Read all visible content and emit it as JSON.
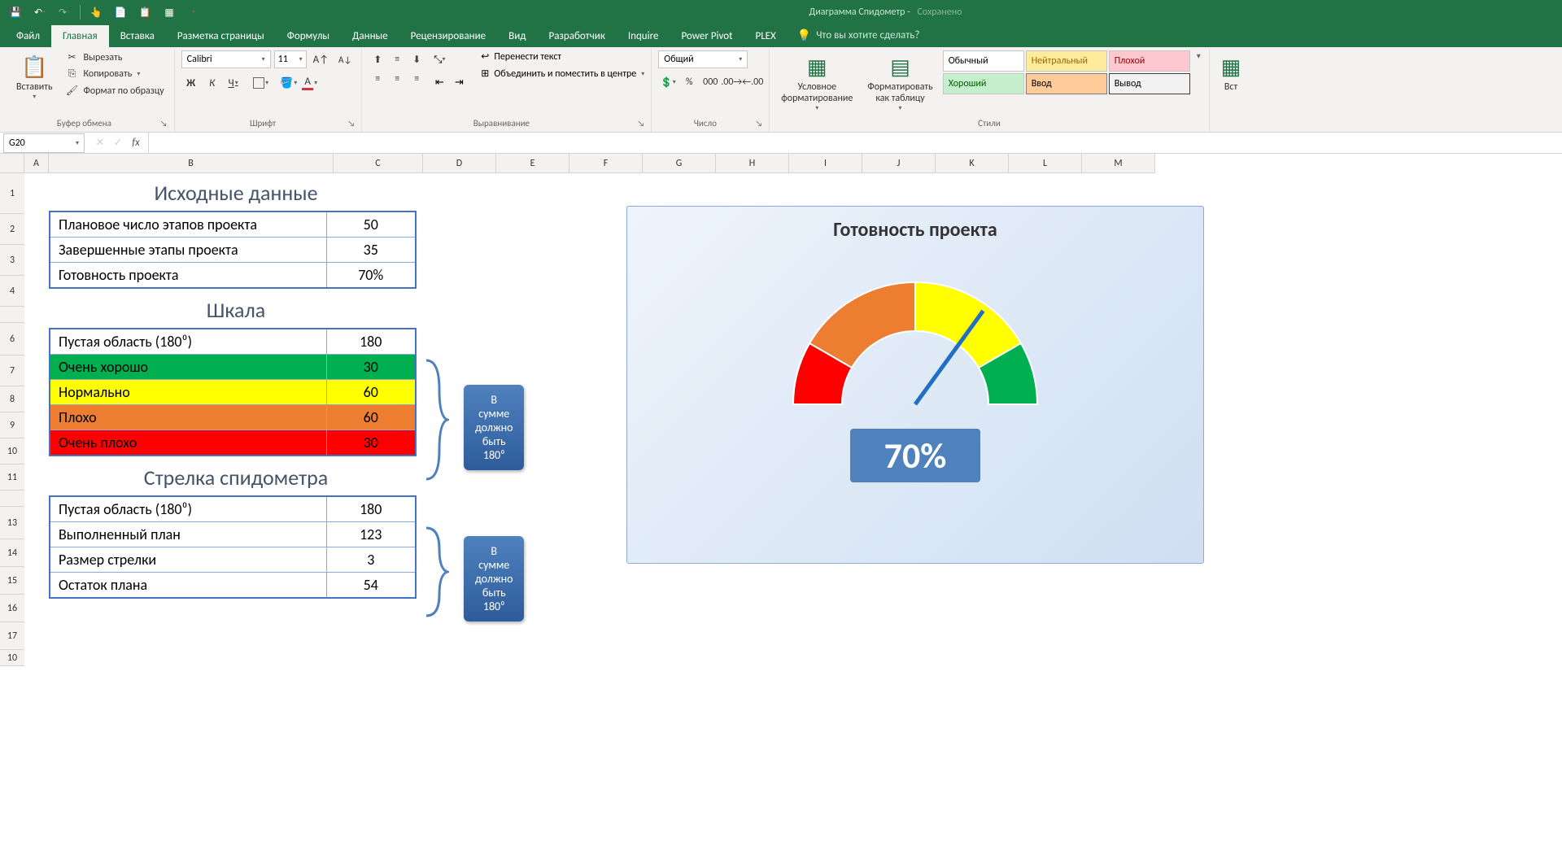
{
  "app": {
    "doc_name": "Диаграмма Спидометр",
    "saved_label": "Сохранено"
  },
  "tabs": {
    "file": "Файл",
    "home": "Главная",
    "insert": "Вставка",
    "layout": "Разметка страницы",
    "formulas": "Формулы",
    "data": "Данные",
    "review": "Рецензирование",
    "view": "Вид",
    "developer": "Разработчик",
    "inquire": "Inquire",
    "powerpivot": "Power Pivot",
    "plex": "PLEX",
    "tell_me": "Что вы хотите сделать?"
  },
  "ribbon": {
    "clipboard": {
      "paste": "Вставить",
      "cut": "Вырезать",
      "copy": "Копировать",
      "format_painter": "Формат по образцу",
      "label": "Буфер обмена"
    },
    "font": {
      "name": "Calibri",
      "size": "11",
      "label": "Шрифт"
    },
    "alignment": {
      "wrap": "Перенести текст",
      "merge": "Объединить и поместить в центре",
      "label": "Выравнивание"
    },
    "number": {
      "format": "Общий",
      "label": "Число"
    },
    "styles": {
      "cond": "Условное\nформатирование",
      "table": "Форматировать\nкак таблицу",
      "s1": "Обычный",
      "s2": "Нейтральный",
      "s3": "Плохой",
      "s4": "Хороший",
      "s5": "Ввод",
      "s6": "Вывод",
      "label": "Стили"
    },
    "insert_partial": "Вст"
  },
  "formula_bar": {
    "name_box": "G20",
    "formula": ""
  },
  "columns": [
    "A",
    "B",
    "C",
    "D",
    "E",
    "F",
    "G",
    "H",
    "I",
    "J",
    "K",
    "L",
    "M"
  ],
  "rows": [
    "1",
    "2",
    "3",
    "4",
    "",
    "6",
    "7",
    "8",
    "9",
    "10",
    "11",
    "",
    "13",
    "14",
    "15",
    "16",
    "17",
    "10"
  ],
  "sheet": {
    "src_title": "Исходные данные",
    "src": [
      {
        "label": "Плановое число этапов проекта",
        "value": "50"
      },
      {
        "label": "Завершенные этапы проекта",
        "value": "35"
      },
      {
        "label": "Готовность проекта",
        "value": "70%"
      }
    ],
    "scale_title": "Шкала",
    "scale": [
      {
        "label": "Пустая область (180⁰)",
        "value": "180",
        "cls": ""
      },
      {
        "label": "Очень хорошо",
        "value": "30",
        "cls": "row-green"
      },
      {
        "label": "Нормально",
        "value": "60",
        "cls": "row-yellow"
      },
      {
        "label": "Плохо",
        "value": "60",
        "cls": "row-orange"
      },
      {
        "label": "Очень плохо",
        "value": "30",
        "cls": "row-red"
      }
    ],
    "needle_title": "Стрелка спидометра",
    "needle": [
      {
        "label": "Пустая область (180⁰)",
        "value": "180"
      },
      {
        "label": "Выполненный план",
        "value": "123"
      },
      {
        "label": "Размер стрелки",
        "value": "3"
      },
      {
        "label": "Остаток плана",
        "value": "54"
      }
    ],
    "callout_sum": "В сумме должно\nбыть 180⁰"
  },
  "chart": {
    "title": "Готовность проекта",
    "percent": "70%"
  },
  "chart_data": {
    "type": "pie",
    "title": "Готовность проекта",
    "note": "Rendered as half-donut speedometer. Bottom 180° hidden; visible top 180° split by segments. Needle at 70% of visible arc.",
    "segments": [
      {
        "name": "Очень плохо",
        "value": 30,
        "color": "#ff0000"
      },
      {
        "name": "Плохо",
        "value": 60,
        "color": "#ed7d31"
      },
      {
        "name": "Нормально",
        "value": 60,
        "color": "#ffff00"
      },
      {
        "name": "Очень хорошо",
        "value": 30,
        "color": "#00b050"
      }
    ],
    "hidden_bottom": 180,
    "needle_percent": 70,
    "center_label": "70%"
  }
}
